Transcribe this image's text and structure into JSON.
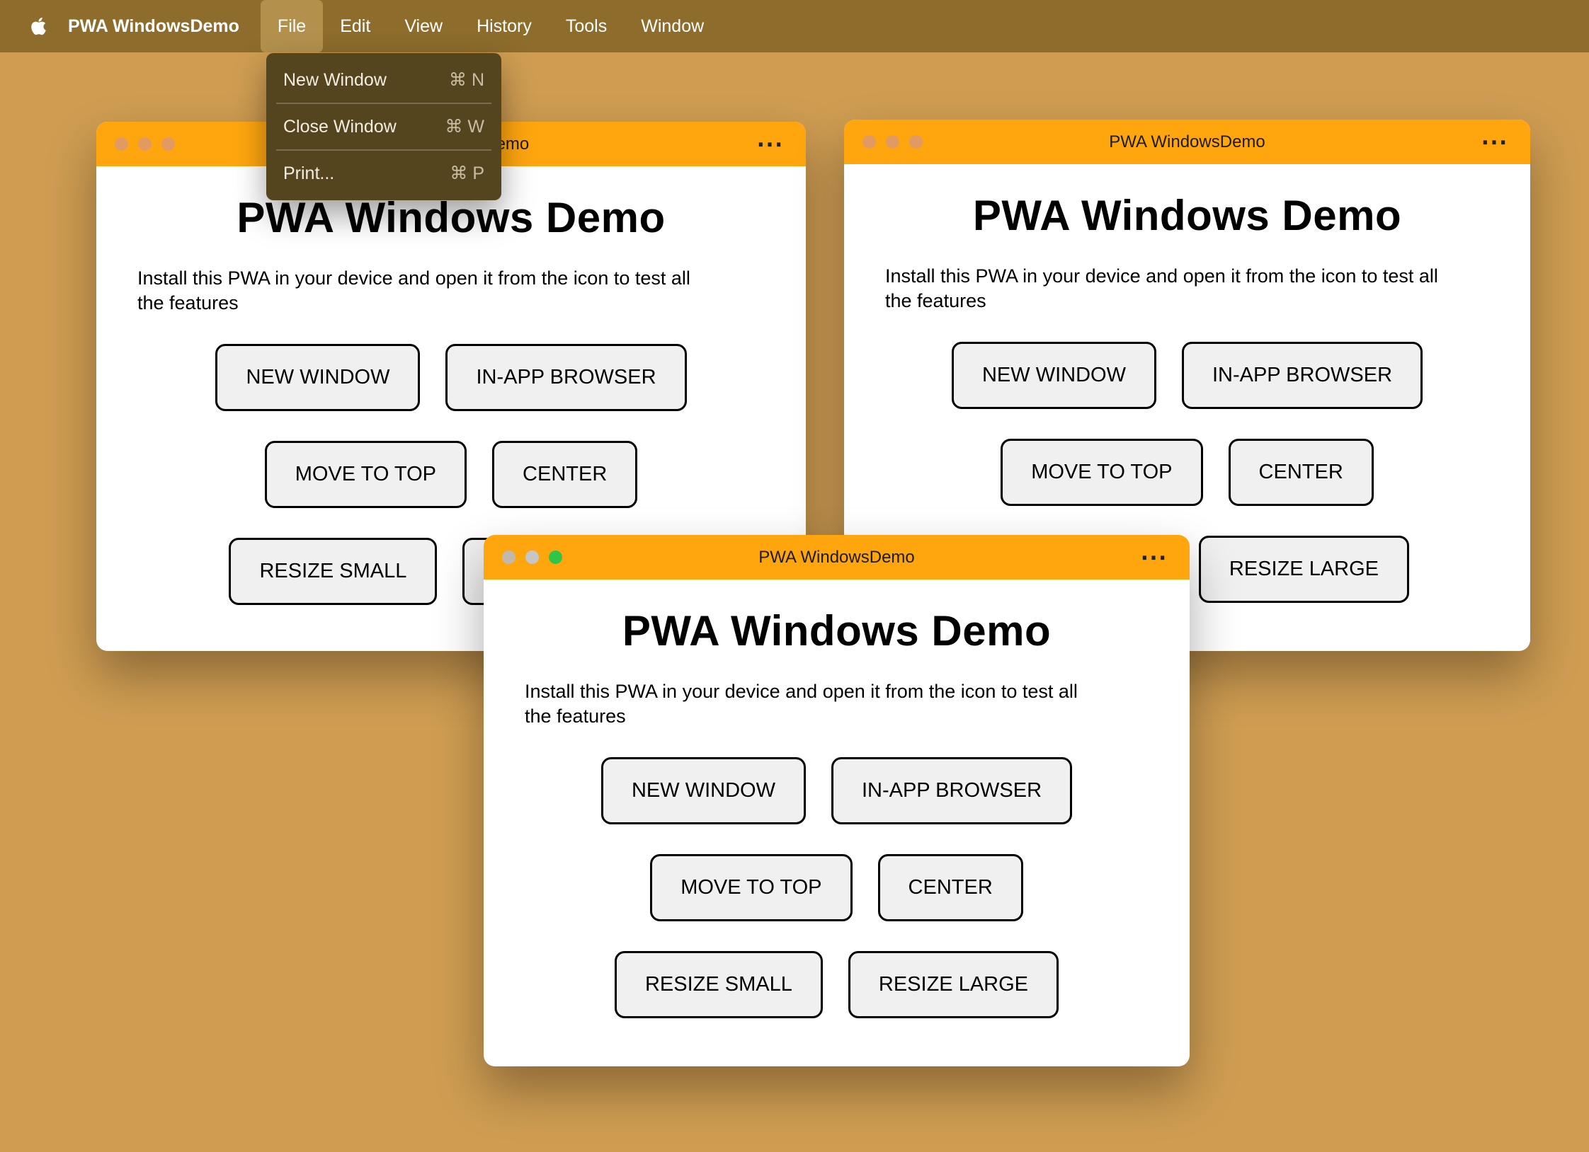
{
  "colors": {
    "desktop": "#cf9d52",
    "menubar-bg": "#8d6c2c",
    "menubar-highlight": "#b3914d",
    "menubar-text": "#ffffff",
    "dropdown-bg": "#55451f",
    "dropdown-text": "#f3ede1",
    "dropdown-shortcut": "#c8bda4",
    "titlebar": "#ffa60f",
    "window-bg": "#ffffff",
    "button-bg": "#f0f0f0",
    "button-border": "#000000",
    "traffic-inactive": "#e09a62",
    "traffic-close": "#c2b8ae",
    "traffic-min": "#c6c6c6",
    "traffic-zoom": "#2fc648"
  },
  "menubar": {
    "app_name": "PWA WindowsDemo",
    "items": [
      {
        "label": "File"
      },
      {
        "label": "Edit"
      },
      {
        "label": "View"
      },
      {
        "label": "History"
      },
      {
        "label": "Tools"
      },
      {
        "label": "Window"
      }
    ]
  },
  "file_menu": {
    "items": [
      {
        "label": "New Window",
        "shortcut": "⌘ N"
      },
      {
        "label": "Close Window",
        "shortcut": "⌘ W"
      },
      {
        "label": "Print...",
        "shortcut": "⌘ P"
      }
    ]
  },
  "window_content": {
    "title": "PWA WindowsDemo",
    "menu_icon": "⋯",
    "heading": "PWA Windows Demo",
    "description": "Install this PWA in your device and open it from the icon to test all the features",
    "buttons": [
      "NEW WINDOW",
      "IN-APP BROWSER",
      "MOVE TO TOP",
      "CENTER",
      "RESIZE SMALL",
      "RESIZE LARGE"
    ]
  }
}
